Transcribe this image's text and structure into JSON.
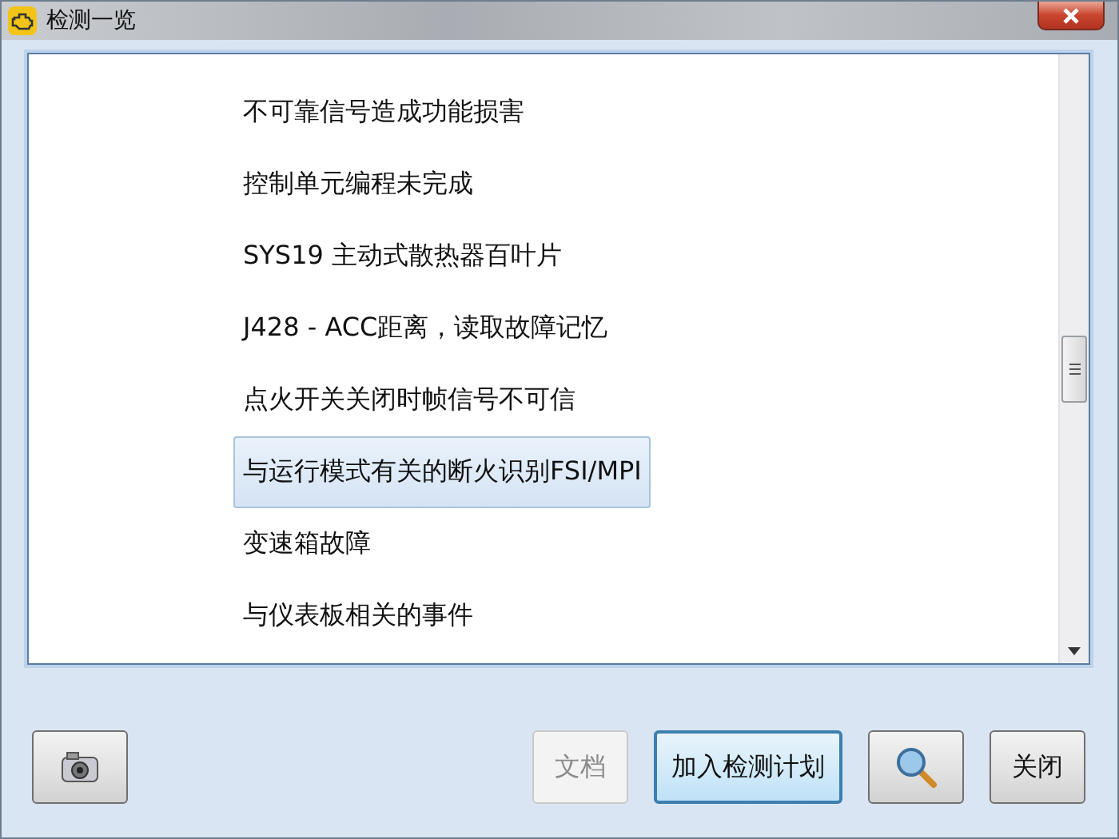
{
  "window": {
    "title": "检测一览"
  },
  "items": [
    {
      "label": "不可靠信号造成功能损害",
      "selected": false
    },
    {
      "label": "控制单元编程未完成",
      "selected": false
    },
    {
      "label": "SYS19 主动式散热器百叶片",
      "selected": false
    },
    {
      "label": "J428 - ACC距离，读取故障记忆",
      "selected": false
    },
    {
      "label": "点火开关关闭时帧信号不可信",
      "selected": false
    },
    {
      "label": "与运行模式有关的断火识别FSI/MPI",
      "selected": true
    },
    {
      "label": "变速箱故障",
      "selected": false
    },
    {
      "label": "与仪表板相关的事件",
      "selected": false
    }
  ],
  "buttons": [
    {
      "label": "文档",
      "disabled": true,
      "default": false
    },
    {
      "label": "加入检测计划",
      "disabled": false,
      "default": true
    },
    {
      "label": "关闭",
      "disabled": false,
      "default": false
    }
  ]
}
